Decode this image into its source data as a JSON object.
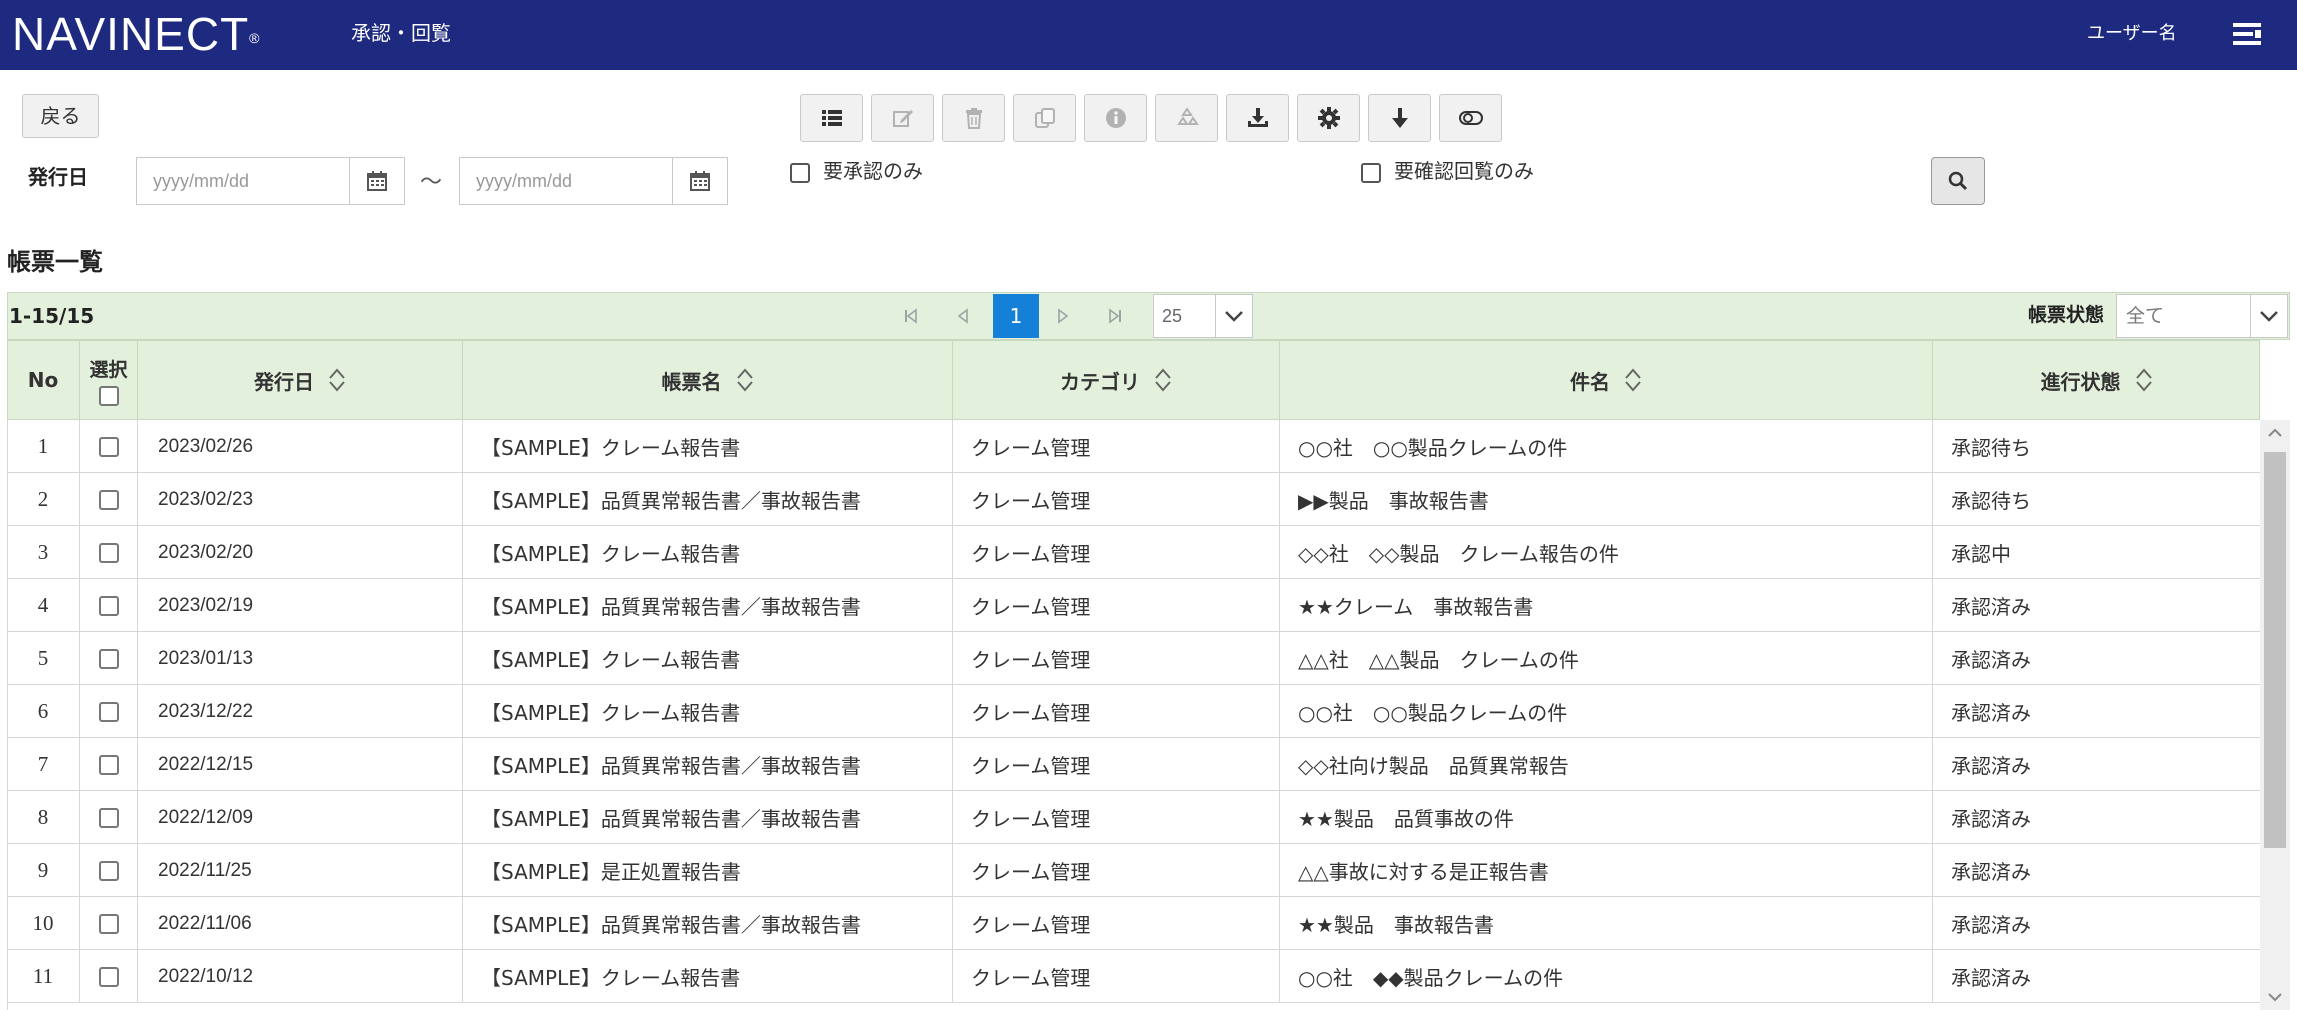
{
  "header": {
    "logo": "NAVINECT",
    "logo_mark": "®",
    "page_title": "承認・回覧",
    "user_name": "ユーザー名"
  },
  "toolbar": {
    "back_label": "戻る",
    "buttons": [
      {
        "icon": "list-icon",
        "enabled": true
      },
      {
        "icon": "edit-icon",
        "enabled": false
      },
      {
        "icon": "trash-icon",
        "enabled": false
      },
      {
        "icon": "copy-icon",
        "enabled": false
      },
      {
        "icon": "info-icon",
        "enabled": false
      },
      {
        "icon": "recycle-icon",
        "enabled": false
      },
      {
        "icon": "download-tray-icon",
        "enabled": true
      },
      {
        "icon": "gear-icon",
        "enabled": true
      },
      {
        "icon": "arrow-down-icon",
        "enabled": true
      },
      {
        "icon": "toggle-icon",
        "enabled": true
      }
    ]
  },
  "filters": {
    "date_label": "発行日",
    "date_from_placeholder": "yyyy/mm/dd",
    "date_to_placeholder": "yyyy/mm/dd",
    "range_separator": "～",
    "approval_only_label": "要承認のみ",
    "confirm_only_label": "要確認回覧のみ"
  },
  "list": {
    "section_title": "帳票一覧",
    "count_text": "1-15/15",
    "current_page": "1",
    "page_size": "25",
    "status_filter_label": "帳票状態",
    "status_filter_value": "全て",
    "columns": {
      "no": "No",
      "select": "選択",
      "issue_date": "発行日",
      "form_name": "帳票名",
      "category": "カテゴリ",
      "subject": "件名",
      "progress": "進行状態"
    },
    "rows": [
      {
        "no": "1",
        "date": "2023/02/26",
        "form": "【SAMPLE】クレーム報告書",
        "category": "クレーム管理",
        "subject": "○○社　○○製品クレームの件",
        "status": "承認待ち"
      },
      {
        "no": "2",
        "date": "2023/02/23",
        "form": "【SAMPLE】品質異常報告書／事故報告書",
        "category": "クレーム管理",
        "subject": "▶▶製品　事故報告書",
        "status": "承認待ち"
      },
      {
        "no": "3",
        "date": "2023/02/20",
        "form": "【SAMPLE】クレーム報告書",
        "category": "クレーム管理",
        "subject": "◇◇社　◇◇製品　クレーム報告の件",
        "status": "承認中"
      },
      {
        "no": "4",
        "date": "2023/02/19",
        "form": "【SAMPLE】品質異常報告書／事故報告書",
        "category": "クレーム管理",
        "subject": "★★クレーム　事故報告書",
        "status": "承認済み"
      },
      {
        "no": "5",
        "date": "2023/01/13",
        "form": "【SAMPLE】クレーム報告書",
        "category": "クレーム管理",
        "subject": "△△社　△△製品　クレームの件",
        "status": "承認済み"
      },
      {
        "no": "6",
        "date": "2023/12/22",
        "form": "【SAMPLE】クレーム報告書",
        "category": "クレーム管理",
        "subject": "○○社　○○製品クレームの件",
        "status": "承認済み"
      },
      {
        "no": "7",
        "date": "2022/12/15",
        "form": "【SAMPLE】品質異常報告書／事故報告書",
        "category": "クレーム管理",
        "subject": "◇◇社向け製品　品質異常報告",
        "status": "承認済み"
      },
      {
        "no": "8",
        "date": "2022/12/09",
        "form": "【SAMPLE】品質異常報告書／事故報告書",
        "category": "クレーム管理",
        "subject": "★★製品　品質事故の件",
        "status": "承認済み"
      },
      {
        "no": "9",
        "date": "2022/11/25",
        "form": "【SAMPLE】是正処置報告書",
        "category": "クレーム管理",
        "subject": "△△事故に対する是正報告書",
        "status": "承認済み"
      },
      {
        "no": "10",
        "date": "2022/11/06",
        "form": "【SAMPLE】品質異常報告書／事故報告書",
        "category": "クレーム管理",
        "subject": "★★製品　事故報告書",
        "status": "承認済み"
      },
      {
        "no": "11",
        "date": "2022/10/12",
        "form": "【SAMPLE】クレーム報告書",
        "category": "クレーム管理",
        "subject": "○○社　◆◆製品クレームの件",
        "status": "承認済み"
      }
    ]
  },
  "colors": {
    "header_bg": "#1e2a80",
    "table_header_bg": "#e3f0dc",
    "active_page": "#1580d8"
  }
}
